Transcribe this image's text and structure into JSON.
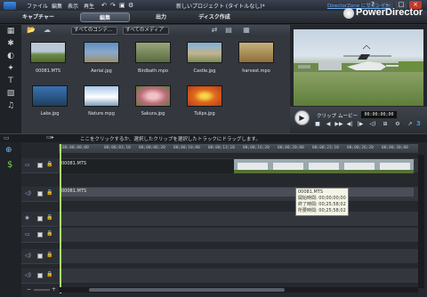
{
  "titlebar": {
    "menus": [
      "ファイル",
      "編集",
      "表示",
      "再生"
    ],
    "document_title": "新しいプロジェクト (タイトルなし)*",
    "window_buttons": [
      "?",
      "–",
      "□",
      "×"
    ]
  },
  "header": {
    "directorzone_link": "DirectorZone にサインイン",
    "brand": "PowerDirector",
    "tabs": [
      {
        "label": "キャプチャー",
        "active": false
      },
      {
        "label": "編集",
        "active": true
      },
      {
        "label": "出力",
        "active": false
      },
      {
        "label": "ディスク作成",
        "active": false
      }
    ]
  },
  "library": {
    "filter_content": "すべてのコンテ...",
    "filter_media": "すべてのメディア",
    "items": [
      {
        "name": "00081.MTS",
        "color": "#7d8c94"
      },
      {
        "name": "Aerial.jpg",
        "color": "#8aa0ba"
      },
      {
        "name": "Birdbath.mpo",
        "color": "#7f8f65"
      },
      {
        "name": "Castle.jpg",
        "color": "#b7a98c"
      },
      {
        "name": "harvest.mpo",
        "color": "#a8905c"
      },
      {
        "name": "Lake.jpg",
        "color": "#4d7fb6"
      },
      {
        "name": "Nature.mpg",
        "color": "#89b1d9"
      },
      {
        "name": "Sakura.jpg",
        "color": "#c78e8f"
      },
      {
        "name": "Tulips.jpg",
        "color": "#d8782a"
      }
    ]
  },
  "preview": {
    "tab_clip": "クリップ",
    "tab_movie": "ムービー",
    "timecode": "00:00:00;00",
    "controls": [
      "■",
      "◀",
      "▶▶",
      "◀|",
      "|▶",
      "◁)",
      "⊞",
      "⚙",
      "↗"
    ]
  },
  "hint": "ここをクリックするか、選択したクリップを選択したトラックにドラッグします。",
  "timeline": {
    "ruler": [
      "00;00;00;00",
      "00;00;03;10",
      "00;00;06;20",
      "00;00;10;00",
      "00;00;13;10",
      "00;00;16;20",
      "00;00;20;00",
      "00;00;23;10",
      "00;00;26;20",
      "00;00;30;00",
      "00;00;33;10",
      "00;00;36;20"
    ],
    "clip_video_label": "00081.MTS",
    "clip_audio_label": "00081.MTS",
    "tooltip": {
      "name": "00081.MTS",
      "start": "開始時間: 00;00;00;00",
      "end": "終了時間: 00;25;58;02",
      "duration": "所要時間: 00;25;58;02"
    }
  }
}
